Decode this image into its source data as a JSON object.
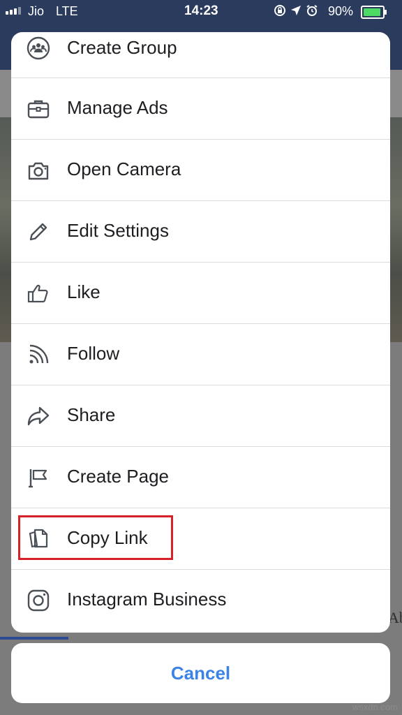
{
  "status_bar": {
    "carrier": "Jio",
    "network": "LTE",
    "time": "14:23",
    "battery_percent": "90%"
  },
  "menu": {
    "items": [
      {
        "label": "Create Group",
        "icon": "group-icon"
      },
      {
        "label": "Manage Ads",
        "icon": "briefcase-icon"
      },
      {
        "label": "Open Camera",
        "icon": "camera-icon"
      },
      {
        "label": "Edit Settings",
        "icon": "pencil-icon"
      },
      {
        "label": "Like",
        "icon": "thumbs-up-icon"
      },
      {
        "label": "Follow",
        "icon": "rss-icon"
      },
      {
        "label": "Share",
        "icon": "share-arrow-icon"
      },
      {
        "label": "Create Page",
        "icon": "flag-icon"
      },
      {
        "label": "Copy Link",
        "icon": "copy-icon",
        "highlighted": true
      },
      {
        "label": "Instagram Business",
        "icon": "instagram-icon"
      }
    ],
    "cancel_label": "Cancel"
  },
  "background": {
    "partial_tab_text": "Ab"
  },
  "watermark": "wsxdn.com",
  "colors": {
    "accent": "#3b83e5",
    "highlight": "#d62128",
    "text": "#1c1e21",
    "icon": "#4b4f56"
  }
}
